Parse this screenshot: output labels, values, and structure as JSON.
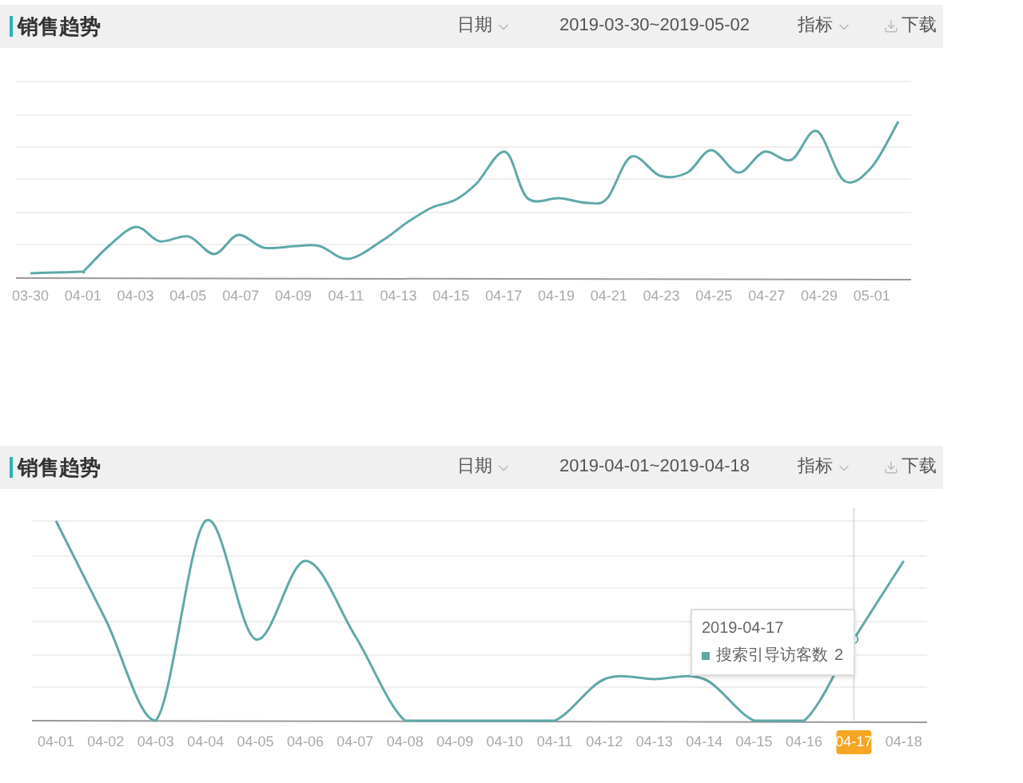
{
  "panels": [
    {
      "title": "销售趋势",
      "date_control": "日期",
      "date_range": "2019-03-30~2019-05-02",
      "metric_control": "指标",
      "download": "下载",
      "chart": {
        "x_labels": [
          {
            "label": "03-30",
            "selected": false
          },
          {
            "label": "04-01",
            "selected": false
          },
          {
            "label": "04-03",
            "selected": false
          },
          {
            "label": "04-05",
            "selected": false
          },
          {
            "label": "04-07",
            "selected": false
          },
          {
            "label": "04-09",
            "selected": false
          },
          {
            "label": "04-11",
            "selected": false
          },
          {
            "label": "04-13",
            "selected": false
          },
          {
            "label": "04-15",
            "selected": false
          },
          {
            "label": "04-17",
            "selected": false
          },
          {
            "label": "04-19",
            "selected": false
          },
          {
            "label": "04-21",
            "selected": false
          },
          {
            "label": "04-23",
            "selected": false
          },
          {
            "label": "04-25",
            "selected": false
          },
          {
            "label": "04-27",
            "selected": false
          },
          {
            "label": "04-29",
            "selected": false
          },
          {
            "label": "05-01",
            "selected": false
          }
        ]
      }
    },
    {
      "title": "销售趋势",
      "date_control": "日期",
      "date_range": "2019-04-01~2019-04-18",
      "metric_control": "指标",
      "download": "下载",
      "chart": {
        "x_labels": [
          {
            "label": "04-01",
            "selected": false
          },
          {
            "label": "04-02",
            "selected": false
          },
          {
            "label": "04-03",
            "selected": false
          },
          {
            "label": "04-04",
            "selected": false
          },
          {
            "label": "04-05",
            "selected": false
          },
          {
            "label": "04-06",
            "selected": false
          },
          {
            "label": "04-07",
            "selected": false
          },
          {
            "label": "04-08",
            "selected": false
          },
          {
            "label": "04-09",
            "selected": false
          },
          {
            "label": "04-10",
            "selected": false
          },
          {
            "label": "04-11",
            "selected": false
          },
          {
            "label": "04-12",
            "selected": false
          },
          {
            "label": "04-13",
            "selected": false
          },
          {
            "label": "04-14",
            "selected": false
          },
          {
            "label": "04-15",
            "selected": false
          },
          {
            "label": "04-16",
            "selected": false
          },
          {
            "label": "04-17",
            "selected": true
          },
          {
            "label": "04-18",
            "selected": false
          }
        ],
        "tooltip": {
          "date": "2019-04-17",
          "series": "搜索引导访客数",
          "value": "2"
        }
      }
    }
  ]
}
